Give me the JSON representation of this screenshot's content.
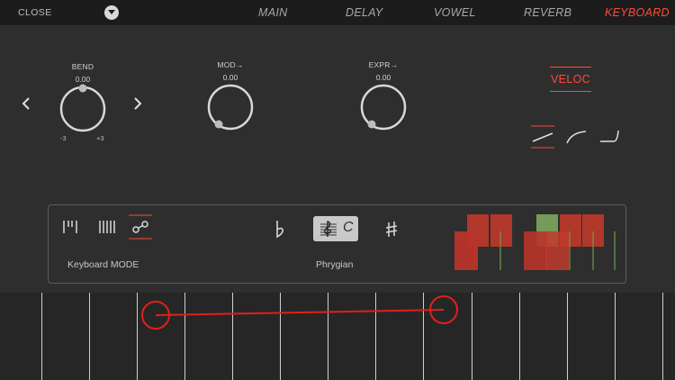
{
  "topbar": {
    "close_label": "CLOSE",
    "tabs": [
      {
        "label": "MAIN",
        "active": false
      },
      {
        "label": "DELAY",
        "active": false
      },
      {
        "label": "VOWEL",
        "active": false
      },
      {
        "label": "REVERB",
        "active": false
      },
      {
        "label": "KEYBOARD",
        "active": true
      }
    ]
  },
  "knobs": {
    "bend": {
      "label": "BEND",
      "value": "0.00",
      "min_label": "-3",
      "max_label": "+3"
    },
    "mod": {
      "label": "MOD→",
      "value": "0.00"
    },
    "expr": {
      "label": "EXPR→",
      "value": "0.00"
    }
  },
  "velocity": {
    "label": "VELOC"
  },
  "mode": {
    "keyboard_mode_label": "Keyboard MODE",
    "scale_label": "Phrygian",
    "key": "C"
  },
  "colors": {
    "accent": "#ff4a38",
    "background": "#2e2e2e",
    "topbar": "#1c1c1c",
    "block_red": "#c0392b",
    "block_green": "#7aa05a"
  },
  "icons": [
    "chevron-left-icon",
    "chevron-right-icon",
    "dropdown-arrow-icon",
    "linear-curve-icon",
    "log-curve-icon",
    "exp-curve-icon",
    "piano-keys-icon",
    "bars-icon",
    "slide-link-icon",
    "flat-icon",
    "treble-clef-icon",
    "sharp-icon"
  ]
}
